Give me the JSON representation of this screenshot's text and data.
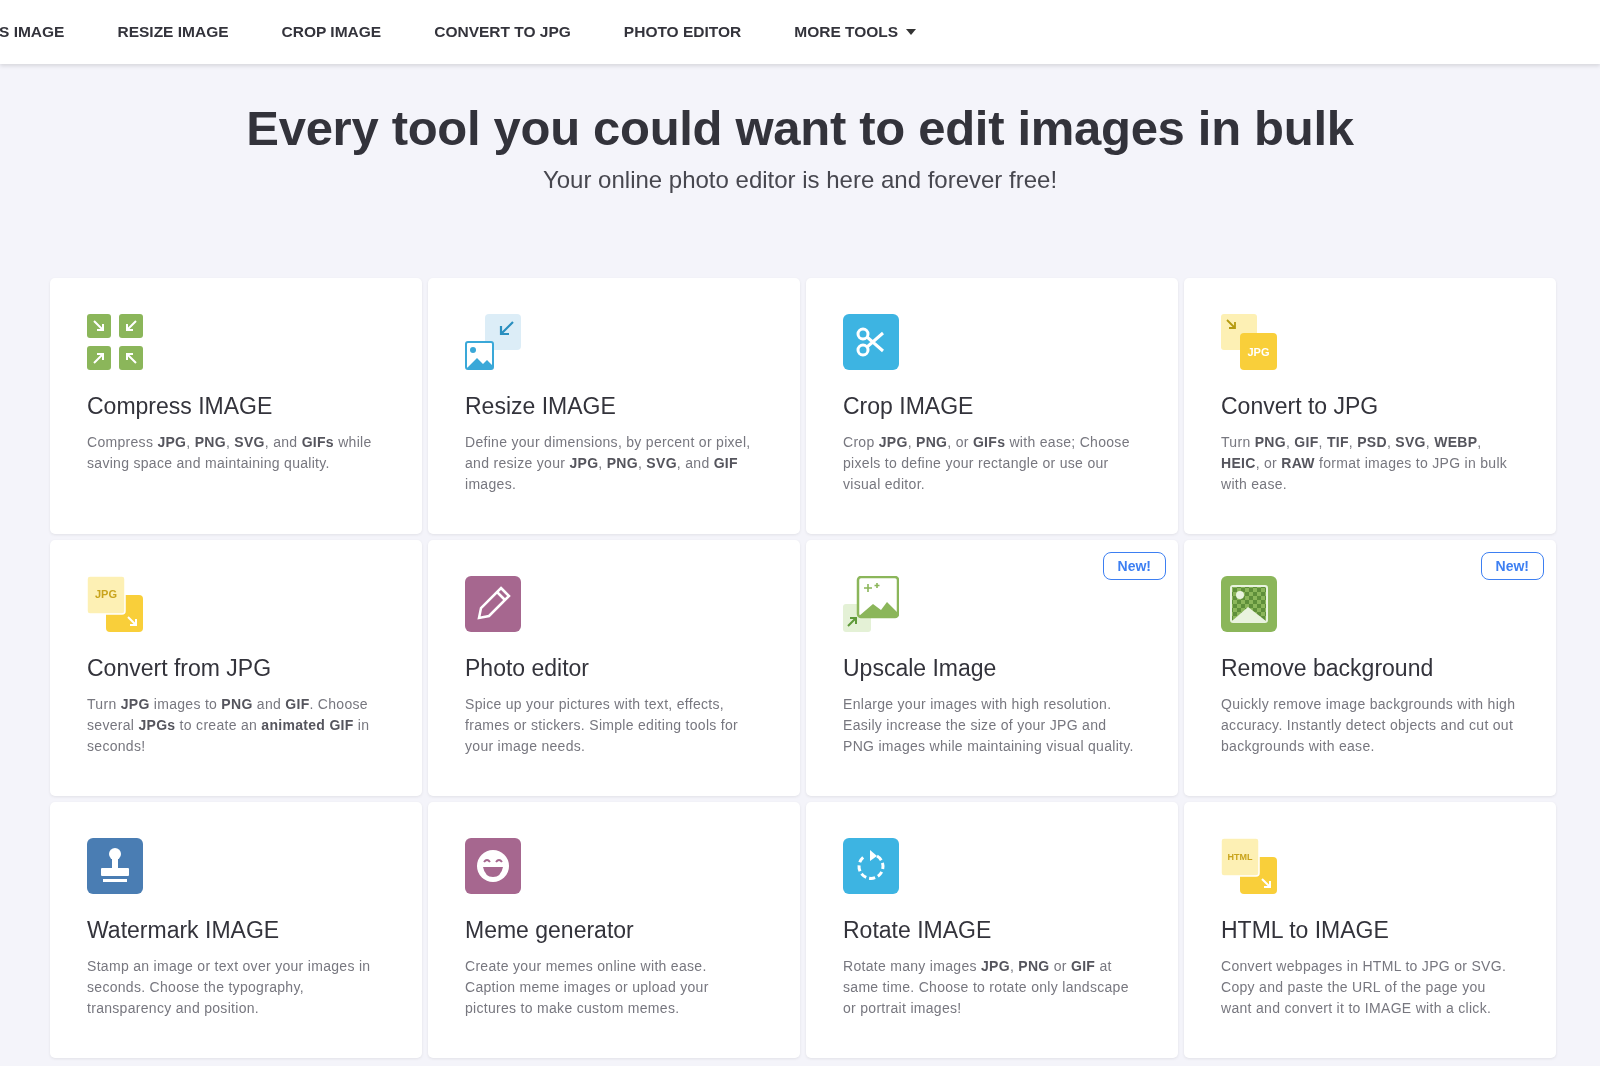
{
  "nav": {
    "items": [
      {
        "label": "S IMAGE"
      },
      {
        "label": "RESIZE IMAGE"
      },
      {
        "label": "CROP IMAGE"
      },
      {
        "label": "CONVERT TO JPG"
      },
      {
        "label": "PHOTO EDITOR"
      },
      {
        "label": "MORE TOOLS",
        "dropdown": true
      }
    ]
  },
  "hero": {
    "title": "Every tool you could want to edit images in bulk",
    "subtitle": "Your online photo editor is here and forever free!"
  },
  "tools": [
    {
      "kind": "compress",
      "title": "Compress IMAGE",
      "description": "Compress **JPG**, **PNG**, **SVG**, and **GIFs** while saving space and maintaining quality."
    },
    {
      "kind": "resize",
      "title": "Resize IMAGE",
      "description": "Define your dimensions, by percent or pixel, and resize your **JPG**, **PNG**, **SVG**, and **GIF** images."
    },
    {
      "kind": "crop",
      "title": "Crop IMAGE",
      "description": "Crop **JPG**, **PNG**, or **GIFs** with ease; Choose pixels to define your rectangle or use our visual editor."
    },
    {
      "kind": "to-jpg",
      "title": "Convert to JPG",
      "icon_text": "JPG",
      "description": "Turn **PNG**, **GIF**, **TIF**, **PSD**, **SVG**, **WEBP**, **HEIC**, or **RAW** format images to JPG in bulk with ease."
    },
    {
      "kind": "from-jpg",
      "title": "Convert from JPG",
      "icon_text": "JPG",
      "description": "Turn **JPG** images to **PNG** and **GIF**. Choose several **JPGs** to create an **animated GIF** in seconds!"
    },
    {
      "kind": "editor",
      "title": "Photo editor",
      "description": "Spice up your pictures with text, effects, frames or stickers. Simple editing tools for your image needs."
    },
    {
      "kind": "upscale",
      "title": "Upscale Image",
      "badge": "New!",
      "description": "Enlarge your images with high resolution. Easily increase the size of your JPG and PNG images while maintaining visual quality."
    },
    {
      "kind": "remove-bg",
      "title": "Remove background",
      "badge": "New!",
      "description": "Quickly remove image backgrounds with high accuracy. Instantly detect objects and cut out backgrounds with ease."
    },
    {
      "kind": "watermark",
      "title": "Watermark IMAGE",
      "description": "Stamp an image or text over your images in seconds. Choose the typography, transparency and position."
    },
    {
      "kind": "meme",
      "title": "Meme generator",
      "description": "Create your memes online with ease. Caption meme images or upload your pictures to make custom memes."
    },
    {
      "kind": "rotate",
      "title": "Rotate IMAGE",
      "description": "Rotate many images **JPG**, **PNG** or **GIF** at same time. Choose to rotate only landscape or portrait images!"
    },
    {
      "kind": "from-html",
      "title": "HTML to IMAGE",
      "icon_text": "HTML",
      "description": "Convert webpages in HTML to JPG or SVG. Copy and paste the URL of the page you want and convert it to IMAGE with a click."
    }
  ]
}
